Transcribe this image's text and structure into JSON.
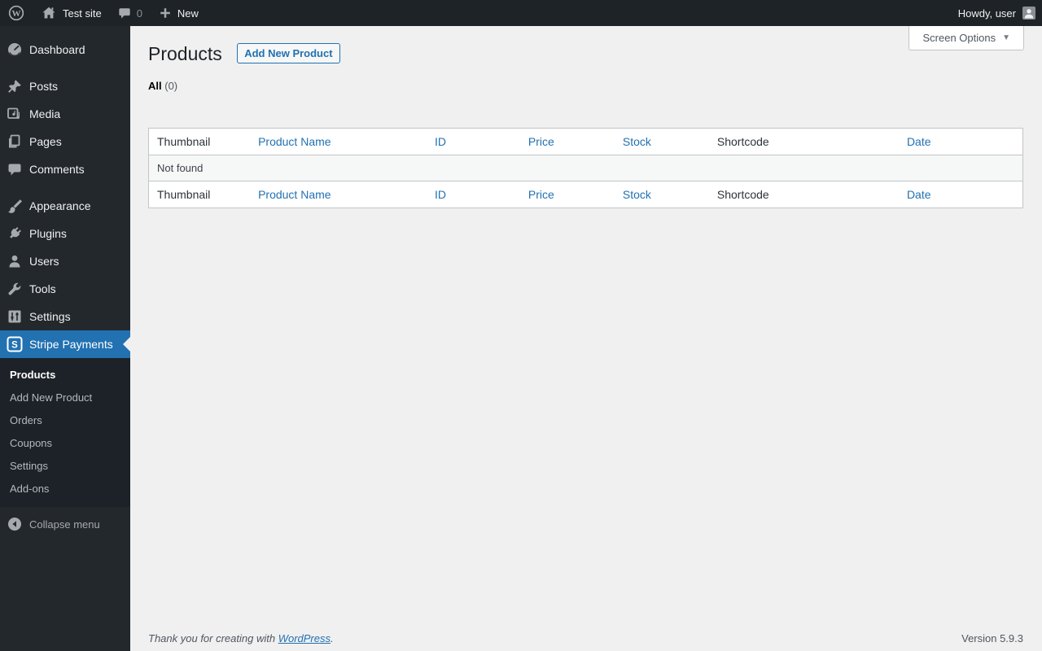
{
  "colors": {
    "accent": "#2271b1",
    "adminbar_bg": "#1d2327",
    "menu_bg": "#23282d",
    "submenu_bg": "#1c2227",
    "content_bg": "#f0f0f1",
    "table_border": "#c3c4c7",
    "link": "#2271b1"
  },
  "admin_bar": {
    "wp_logo_icon": "wordpress-logo-icon",
    "site_name": "Test site",
    "comment_count": "0",
    "new_label": "New",
    "howdy_text": "Howdy, user"
  },
  "sidebar": {
    "items": [
      {
        "label": "Dashboard",
        "icon": "dashboard-gauge-icon"
      },
      {
        "label": "Posts",
        "icon": "pushpin-icon"
      },
      {
        "label": "Media",
        "icon": "media-icon"
      },
      {
        "label": "Pages",
        "icon": "pages-icon"
      },
      {
        "label": "Comments",
        "icon": "comment-bubble-icon"
      },
      {
        "label": "Appearance",
        "icon": "paintbrush-icon"
      },
      {
        "label": "Plugins",
        "icon": "plug-icon"
      },
      {
        "label": "Users",
        "icon": "user-icon"
      },
      {
        "label": "Tools",
        "icon": "wrench-icon"
      },
      {
        "label": "Settings",
        "icon": "settings-sliders-icon"
      }
    ],
    "active_item": {
      "label": "Stripe Payments",
      "icon": "stripe-s-icon"
    },
    "submenu": {
      "items": [
        {
          "label": "Products",
          "current": true
        },
        {
          "label": "Add New Product",
          "current": false
        },
        {
          "label": "Orders",
          "current": false
        },
        {
          "label": "Coupons",
          "current": false
        },
        {
          "label": "Settings",
          "current": false
        },
        {
          "label": "Add-ons",
          "current": false
        }
      ]
    },
    "collapse_label": "Collapse menu"
  },
  "main": {
    "page_title": "Products",
    "add_new_button_label": "Add New Product",
    "screen_options_label": "Screen Options",
    "screen_options_caret": "▼",
    "filter": {
      "all_label": "All",
      "count": "(0)"
    },
    "table": {
      "columns": [
        {
          "label": "Thumbnail",
          "sortable": false
        },
        {
          "label": "Product Name",
          "sortable": true
        },
        {
          "label": "ID",
          "sortable": true
        },
        {
          "label": "Price",
          "sortable": true
        },
        {
          "label": "Stock",
          "sortable": true
        },
        {
          "label": "Shortcode",
          "sortable": false
        },
        {
          "label": "Date",
          "sortable": true
        }
      ],
      "empty_message": "Not found"
    }
  },
  "footer": {
    "thanks_prefix": "Thank you for creating with ",
    "wordpress_link_label": "WordPress",
    "thanks_suffix": ".",
    "version": "Version 5.9.3"
  }
}
